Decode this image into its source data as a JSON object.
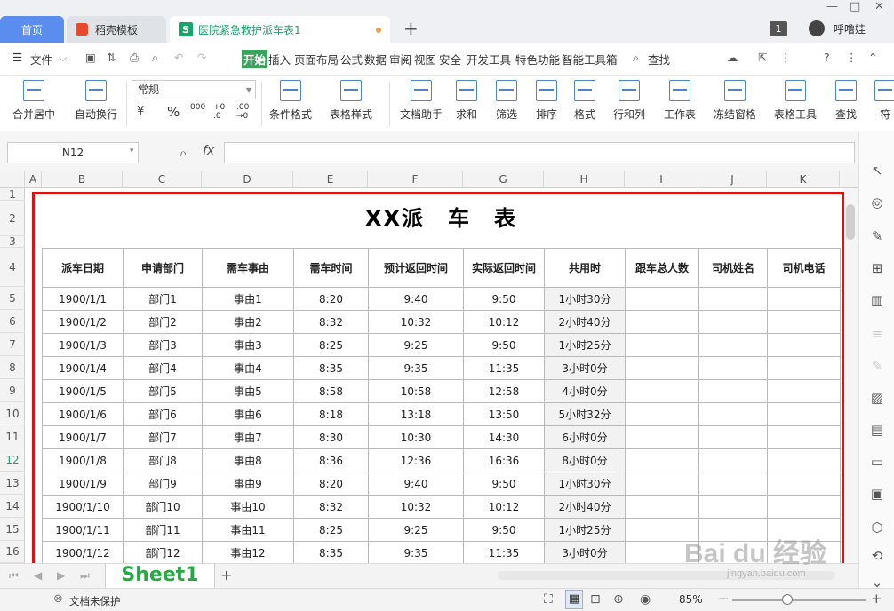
{
  "tabs": {
    "home": "首页",
    "template": "稻壳模板",
    "file": "医院紧急救护派车表1",
    "file_icon": "S",
    "new_tab": "+"
  },
  "user": {
    "badge": "1",
    "name": "呼噜娃"
  },
  "menu": {
    "file": "文件",
    "items": [
      "开始",
      "插入",
      "页面布局",
      "公式",
      "数据",
      "审阅",
      "视图",
      "安全",
      "开发工具",
      "特色功能",
      "智能工具箱"
    ],
    "search": "查找"
  },
  "ribbon": {
    "merge": "合并居中",
    "wrap": "自动换行",
    "format_select": "常规",
    "currency": "¥",
    "percent": "%",
    "thousands": "000",
    "inc_dec": "+0 .0",
    "dec_dec": ".00 →0",
    "cond_format": "条件格式",
    "table_style": "表格样式",
    "doc_helper": "文档助手",
    "sum": "求和",
    "filter": "筛选",
    "sort": "排序",
    "format": "格式",
    "rowcol": "行和列",
    "worksheet": "工作表",
    "freeze": "冻结窗格",
    "table_tools": "表格工具",
    "find": "查找",
    "symbol": "符"
  },
  "formula": {
    "namebox": "N12",
    "fx": "fx",
    "value": ""
  },
  "columns": [
    "A",
    "B",
    "C",
    "D",
    "E",
    "F",
    "G",
    "H",
    "I",
    "J",
    "K"
  ],
  "rows": [
    "1",
    "2",
    "3",
    "4",
    "5",
    "6",
    "7",
    "8",
    "9",
    "10",
    "11",
    "12",
    "13",
    "14",
    "15",
    "16"
  ],
  "sheet": {
    "title": "XX派　车　表",
    "headers": [
      "派车日期",
      "申请部门",
      "需车事由",
      "需车时间",
      "预计返回时间",
      "实际返回时间",
      "共用时",
      "跟车总人数",
      "司机姓名",
      "司机电话"
    ],
    "data": [
      [
        "1900/1/1",
        "部门1",
        "事由1",
        "8:20",
        "9:40",
        "9:50",
        "1小时30分",
        "",
        "",
        ""
      ],
      [
        "1900/1/2",
        "部门2",
        "事由2",
        "8:32",
        "10:32",
        "10:12",
        "2小时40分",
        "",
        "",
        ""
      ],
      [
        "1900/1/3",
        "部门3",
        "事由3",
        "8:25",
        "9:25",
        "9:50",
        "1小时25分",
        "",
        "",
        ""
      ],
      [
        "1900/1/4",
        "部门4",
        "事由4",
        "8:35",
        "9:35",
        "11:35",
        "3小时0分",
        "",
        "",
        ""
      ],
      [
        "1900/1/5",
        "部门5",
        "事由5",
        "8:58",
        "10:58",
        "12:58",
        "4小时0分",
        "",
        "",
        ""
      ],
      [
        "1900/1/6",
        "部门6",
        "事由6",
        "8:18",
        "13:18",
        "13:50",
        "5小时32分",
        "",
        "",
        ""
      ],
      [
        "1900/1/7",
        "部门7",
        "事由7",
        "8:30",
        "10:30",
        "14:30",
        "6小时0分",
        "",
        "",
        ""
      ],
      [
        "1900/1/8",
        "部门8",
        "事由8",
        "8:36",
        "12:36",
        "16:36",
        "8小时0分",
        "",
        "",
        ""
      ],
      [
        "1900/1/9",
        "部门9",
        "事由9",
        "8:20",
        "9:40",
        "9:50",
        "1小时30分",
        "",
        "",
        ""
      ],
      [
        "1900/1/10",
        "部门10",
        "事由10",
        "8:32",
        "10:32",
        "10:12",
        "2小时40分",
        "",
        "",
        ""
      ],
      [
        "1900/1/11",
        "部门11",
        "事由11",
        "8:25",
        "9:25",
        "9:50",
        "1小时25分",
        "",
        "",
        ""
      ],
      [
        "1900/1/12",
        "部门12",
        "事由12",
        "8:35",
        "9:35",
        "11:35",
        "3小时0分",
        "",
        "",
        ""
      ]
    ]
  },
  "sheet_tab": "Sheet1",
  "add_sheet": "+",
  "status": {
    "protect": "文档未保护",
    "zoom": "85%"
  },
  "watermark": {
    "brand": "Bai du 经验",
    "url": "jingyan.baidu.com"
  },
  "colors": {
    "accent": "#3ba55c",
    "tab_active": "#5a8dee",
    "highlight_box": "#e01010",
    "sheet_tab_text": "#27a844"
  }
}
